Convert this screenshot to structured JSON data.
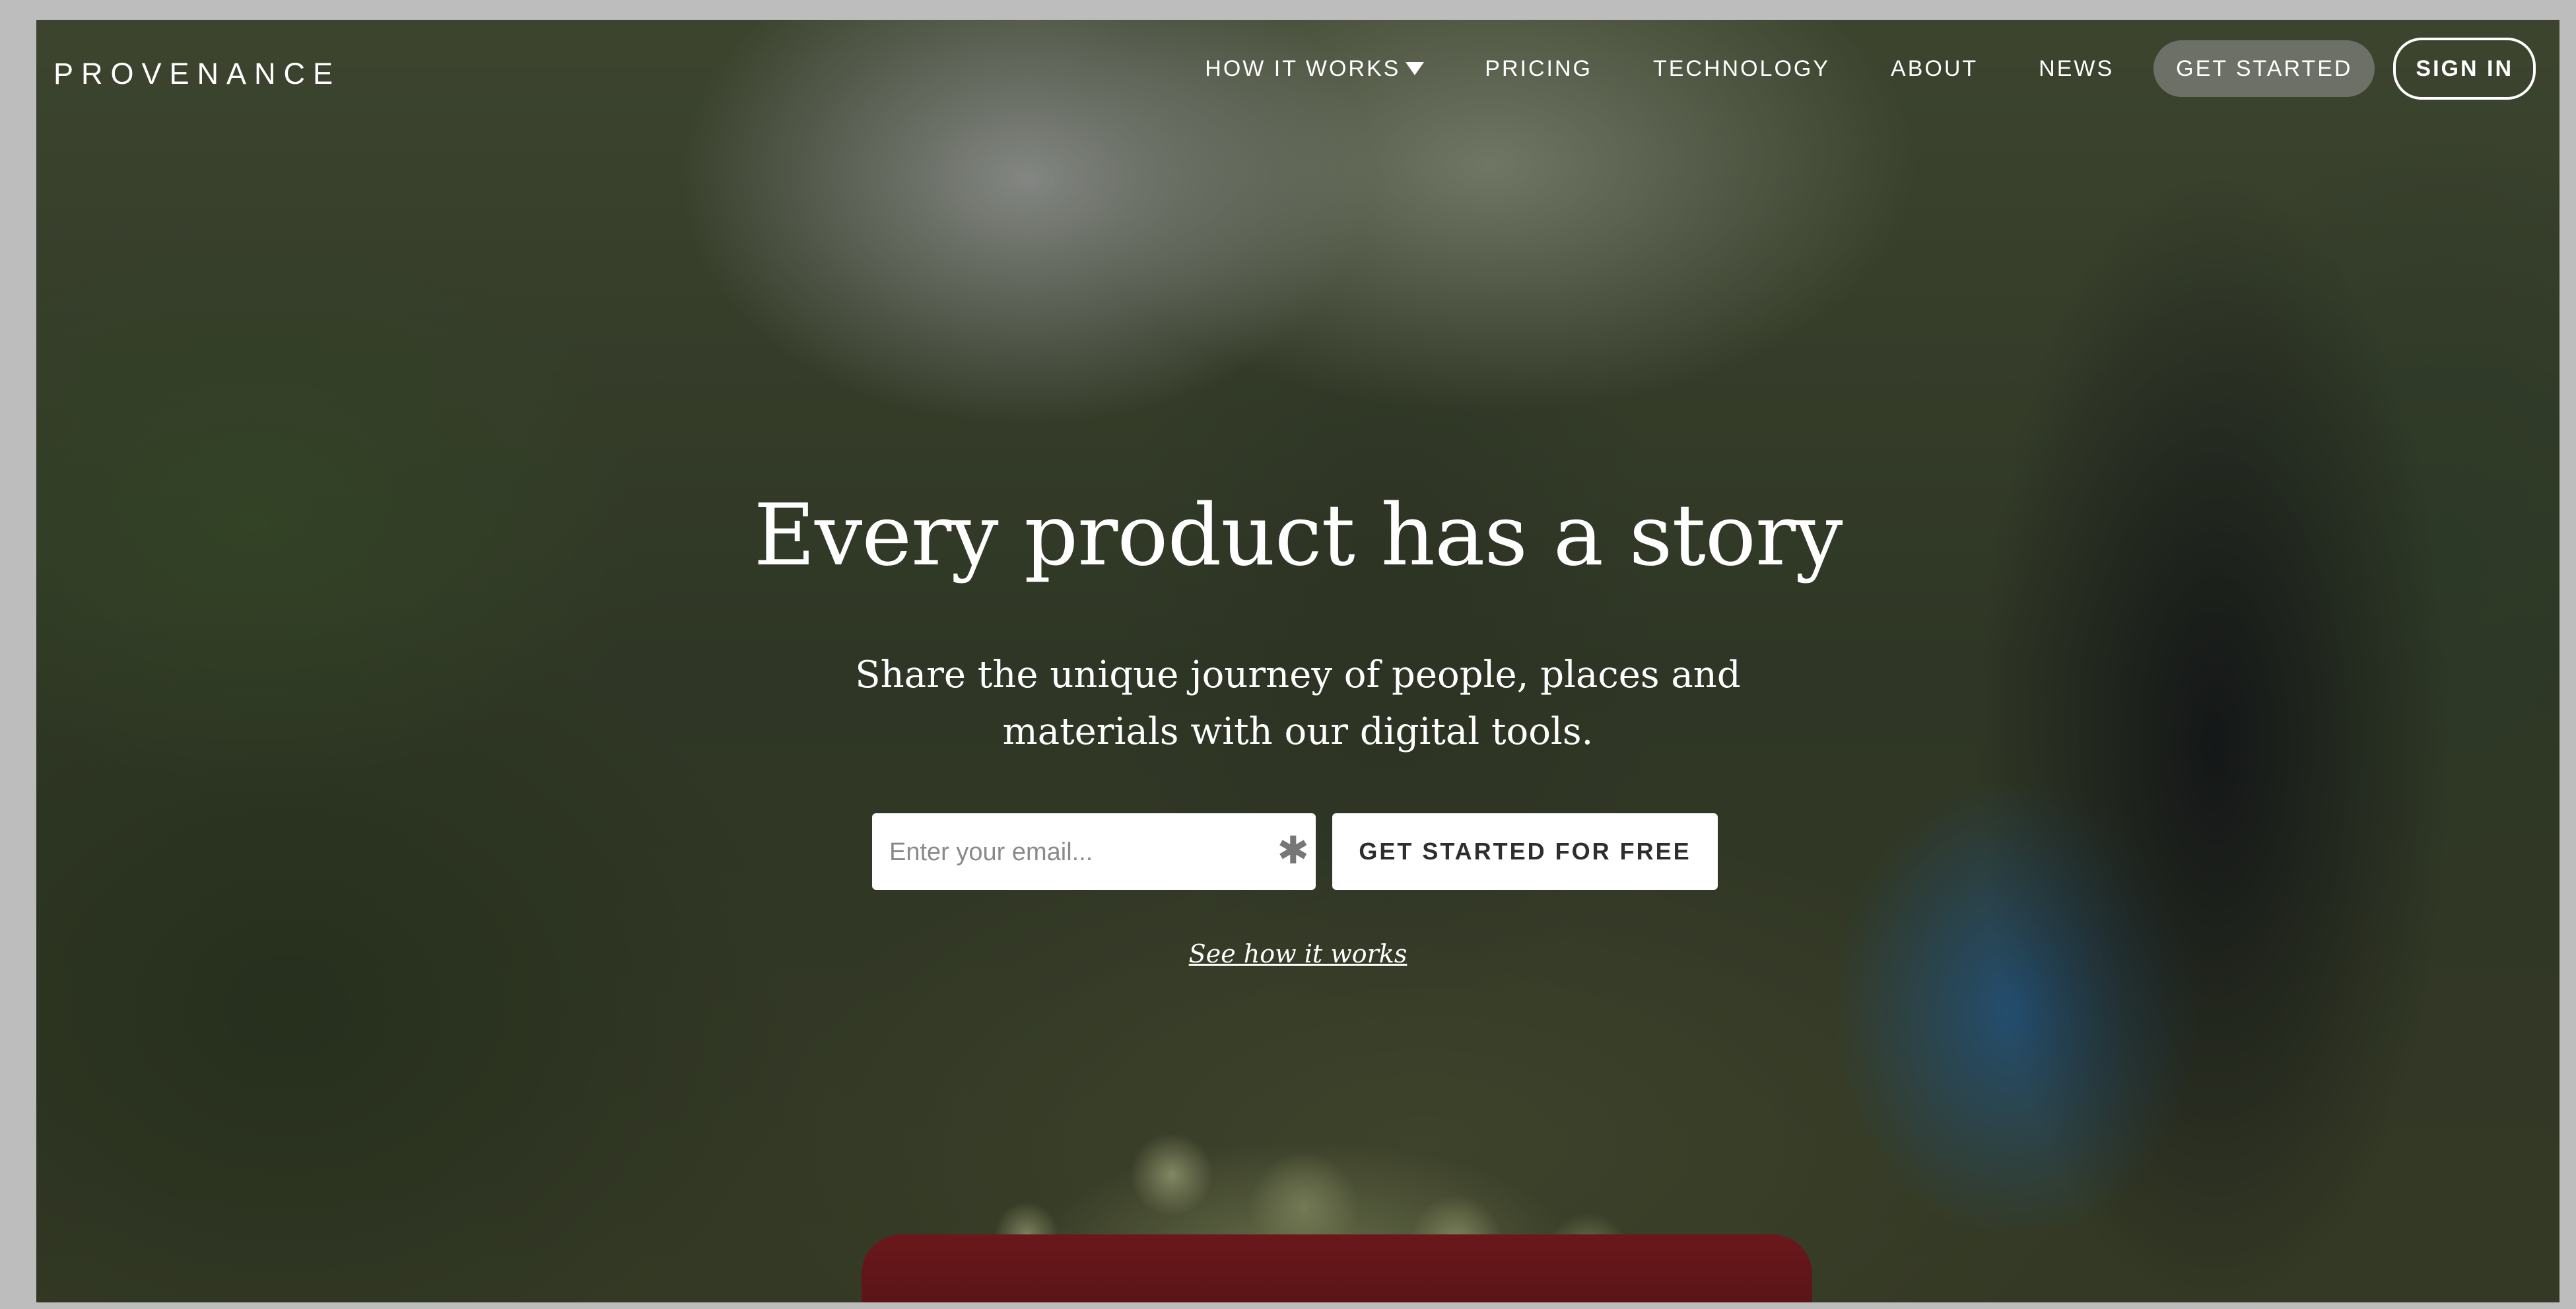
{
  "brand": {
    "logo_text": "PROVENANCE"
  },
  "nav": {
    "items": [
      {
        "label": "HOW IT WORKS",
        "has_dropdown": true
      },
      {
        "label": "PRICING"
      },
      {
        "label": "TECHNOLOGY"
      },
      {
        "label": "ABOUT"
      },
      {
        "label": "NEWS"
      }
    ],
    "get_started_label": "GET STARTED",
    "sign_in_label": "SIGN IN"
  },
  "hero": {
    "headline": "Every product has a story",
    "subheadline_line1": "Share the unique journey of people, places and",
    "subheadline_line2": "materials with our digital tools.",
    "email_placeholder": "Enter your email...",
    "required_marker": "✱",
    "cta_label": "GET STARTED FOR FREE",
    "see_how_label": "See how it works"
  },
  "colors": {
    "text": "#ffffff",
    "button_bg": "#ffffff",
    "button_text": "#2e2e2e",
    "overlay": "rgba(20,22,20,0.38)"
  }
}
